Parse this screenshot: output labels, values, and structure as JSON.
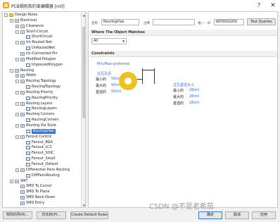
{
  "window": {
    "title": "PCB规则及约束编辑器 [mil]",
    "help": "?",
    "close": "✕"
  },
  "tree": {
    "rows": [
      {
        "label": "Design Rules",
        "level": 0,
        "exp": "-",
        "icon": "folder"
      },
      {
        "label": "Electrical",
        "level": 1,
        "exp": "-",
        "icon": "rule"
      },
      {
        "label": "Clearance",
        "level": 2,
        "exp": "+",
        "icon": "rule"
      },
      {
        "label": "Short-Circuit",
        "level": 2,
        "exp": "-",
        "icon": "rule"
      },
      {
        "label": "ShortCircuit",
        "level": 3,
        "exp": "",
        "icon": "item"
      },
      {
        "label": "Un-Routed Net",
        "level": 2,
        "exp": "-",
        "icon": "rule"
      },
      {
        "label": "UnRoutedNet",
        "level": 3,
        "exp": "",
        "icon": "item"
      },
      {
        "label": "Un-Connected Pin",
        "level": 2,
        "exp": "",
        "icon": "rule"
      },
      {
        "label": "Modified Polygon",
        "level": 2,
        "exp": "-",
        "icon": "rule"
      },
      {
        "label": "UnpouredPolygon",
        "level": 3,
        "exp": "",
        "icon": "item"
      },
      {
        "label": "Routing",
        "level": 1,
        "exp": "-",
        "icon": "rule"
      },
      {
        "label": "Width",
        "level": 2,
        "exp": "+",
        "icon": "rule"
      },
      {
        "label": "Routing Topology",
        "level": 2,
        "exp": "-",
        "icon": "rule"
      },
      {
        "label": "RoutingTopology",
        "level": 3,
        "exp": "",
        "icon": "item"
      },
      {
        "label": "Routing Priority",
        "level": 2,
        "exp": "-",
        "icon": "rule"
      },
      {
        "label": "RoutingPriority",
        "level": 3,
        "exp": "",
        "icon": "item"
      },
      {
        "label": "Routing Layers",
        "level": 2,
        "exp": "-",
        "icon": "rule"
      },
      {
        "label": "RoutingLayers",
        "level": 3,
        "exp": "",
        "icon": "item"
      },
      {
        "label": "Routing Corners",
        "level": 2,
        "exp": "-",
        "icon": "rule"
      },
      {
        "label": "RoutingCorners",
        "level": 3,
        "exp": "",
        "icon": "item"
      },
      {
        "label": "Routing Via Style",
        "level": 2,
        "exp": "-",
        "icon": "rule"
      },
      {
        "label": "RoutingVias",
        "level": 3,
        "exp": "",
        "icon": "item",
        "selected": true
      },
      {
        "label": "Fanout Control",
        "level": 2,
        "exp": "-",
        "icon": "rule"
      },
      {
        "label": "Fanout_BGA",
        "level": 3,
        "exp": "",
        "icon": "item"
      },
      {
        "label": "Fanout_LCC",
        "level": 3,
        "exp": "",
        "icon": "item"
      },
      {
        "label": "Fanout_SOIC",
        "level": 3,
        "exp": "",
        "icon": "item"
      },
      {
        "label": "Fanout_Small",
        "level": 3,
        "exp": "",
        "icon": "item"
      },
      {
        "label": "Fanout_Default",
        "level": 3,
        "exp": "",
        "icon": "item"
      },
      {
        "label": "Differential Pairs Routing",
        "level": 2,
        "exp": "-",
        "icon": "rule"
      },
      {
        "label": "DiffPairsRouting",
        "level": 3,
        "exp": "",
        "icon": "item"
      },
      {
        "label": "SMT",
        "level": 1,
        "exp": "-",
        "icon": "rule"
      },
      {
        "label": "SMD To Corner",
        "level": 2,
        "exp": "",
        "icon": "rule"
      },
      {
        "label": "SMD To Plane",
        "level": 2,
        "exp": "",
        "icon": "rule"
      },
      {
        "label": "SMD Neck-Down",
        "level": 2,
        "exp": "",
        "icon": "rule"
      },
      {
        "label": "SMD Entry",
        "level": 2,
        "exp": "",
        "icon": "rule"
      }
    ]
  },
  "rule": {
    "name_label": "名称",
    "name_value": "RoutingVias",
    "comment_label": "注释",
    "comment_value": "",
    "unique_id_label": "唯一 - ID",
    "unique_id_value": "WOSSGGOU",
    "test_queries_button": "Test Queries"
  },
  "where": {
    "header": "Where The Object Matches",
    "dropdown_value": "All"
  },
  "constraints": {
    "header": "Constraints",
    "via_pref": "Min/Max-preferred",
    "hole_title": "过孔孔径",
    "via_title": "过孔直径大小",
    "rows_left": [
      {
        "label": "最小的",
        "value": "50mil"
      },
      {
        "label": "最大的",
        "value": "50mil"
      },
      {
        "label": "首选的",
        "value": "50mil"
      }
    ],
    "rows_right": [
      {
        "label": "最小的",
        "value": "28mil"
      },
      {
        "label": "最大的",
        "value": "28mil"
      },
      {
        "label": "首选的",
        "value": "28mil"
      }
    ]
  },
  "footer": {
    "rule_wizard": "规则向导(R)...",
    "priorities": "优先权(P)...",
    "create_default": "Create Default Rules",
    "ok": "确定",
    "cancel": "取消",
    "apply": "应用"
  },
  "watermark": "CSDN @不是老希茄",
  "colors": {
    "accent": "#3779d6",
    "value_blue": "#2f6bd8",
    "pad_yellow": "#f0c01c"
  }
}
